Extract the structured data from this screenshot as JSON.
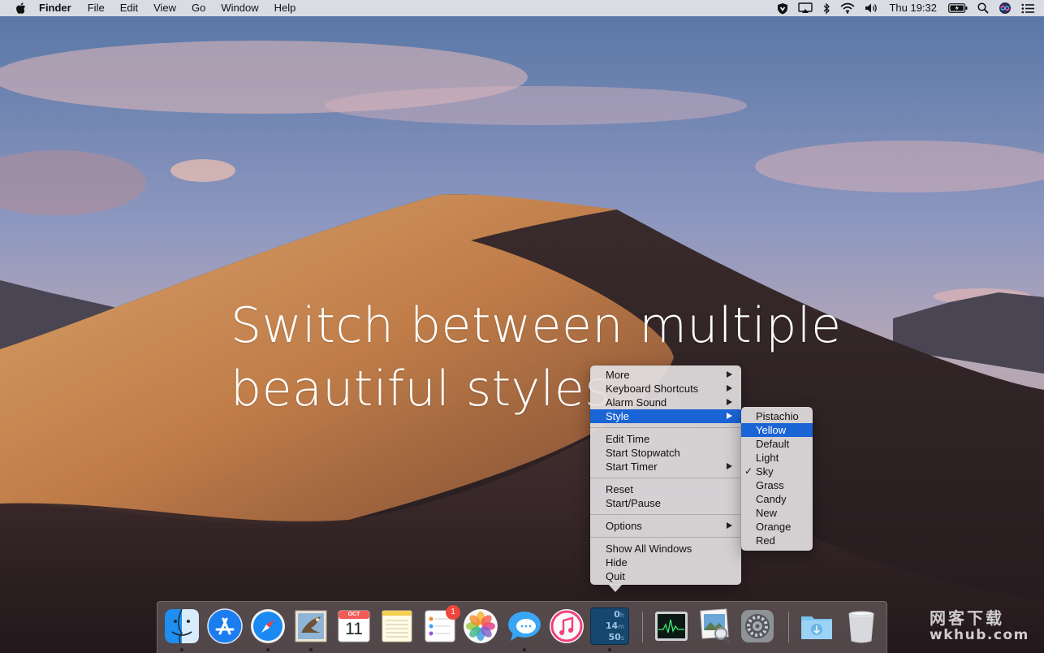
{
  "menubar": {
    "app_name": "Finder",
    "menus": [
      "File",
      "Edit",
      "View",
      "Go",
      "Window",
      "Help"
    ],
    "clock": "Thu 19:32",
    "status_icons": [
      "vpn-shield-icon",
      "airplay-icon",
      "bluetooth-icon",
      "wifi-icon",
      "volume-icon",
      "battery-icon",
      "spotlight-icon",
      "siri-icon",
      "notification-center-icon"
    ]
  },
  "headline": {
    "line1": "Switch between multiple",
    "line2": "beautiful styles"
  },
  "context_menu": {
    "groups": [
      [
        {
          "label": "More",
          "submenu": true
        },
        {
          "label": "Keyboard Shortcuts",
          "submenu": true
        },
        {
          "label": "Alarm Sound",
          "submenu": true
        },
        {
          "label": "Style",
          "submenu": true,
          "highlighted": true
        }
      ],
      [
        {
          "label": "Edit Time",
          "submenu": false
        },
        {
          "label": "Start Stopwatch",
          "submenu": false
        },
        {
          "label": "Start Timer",
          "submenu": true
        }
      ],
      [
        {
          "label": "Reset",
          "submenu": false
        },
        {
          "label": "Start/Pause",
          "submenu": false
        }
      ],
      [
        {
          "label": "Options",
          "submenu": true
        }
      ],
      [
        {
          "label": "Show All Windows",
          "submenu": false
        },
        {
          "label": "Hide",
          "submenu": false
        },
        {
          "label": "Quit",
          "submenu": false
        }
      ]
    ]
  },
  "style_menu": {
    "items": [
      {
        "label": "Pistachio"
      },
      {
        "label": "Yellow",
        "highlighted": true
      },
      {
        "label": "Default"
      },
      {
        "label": "Light"
      },
      {
        "label": "Sky",
        "checked": true
      },
      {
        "label": "Grass"
      },
      {
        "label": "Candy"
      },
      {
        "label": "New"
      },
      {
        "label": "Orange"
      },
      {
        "label": "Red"
      }
    ],
    "check_glyph": "✓"
  },
  "dock": {
    "calendar": {
      "month": "OCT",
      "day": "11"
    },
    "reminders_badge": "1",
    "timer": {
      "h": "0",
      "h_unit": "h",
      "m": "14",
      "m_unit": "m",
      "s": "50",
      "s_unit": "s"
    },
    "apps": [
      "finder-icon",
      "app-store-icon",
      "safari-icon",
      "mail-icon",
      "calendar-icon",
      "notes-icon",
      "reminders-icon",
      "photos-icon",
      "messages-icon",
      "itunes-icon",
      "timer-app-icon",
      "activity-monitor-icon",
      "preview-icon",
      "system-preferences-icon",
      "downloads-folder-icon",
      "trash-icon"
    ]
  },
  "watermark": {
    "line1": "网客下载",
    "line2": "wkhub.com"
  }
}
